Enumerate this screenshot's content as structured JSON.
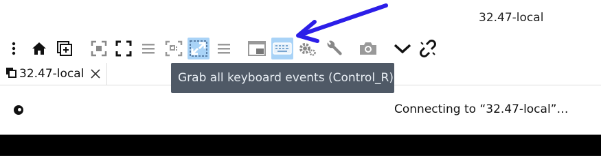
{
  "window": {
    "title": "32.47-local"
  },
  "toolbar": {
    "items": [
      {
        "icon": "kebab-menu-icon"
      },
      {
        "icon": "home-icon"
      },
      {
        "icon": "new-window-icon"
      },
      {
        "icon": "fit-window-icon"
      },
      {
        "icon": "fullscreen-icon"
      },
      {
        "icon": "menu-lines-icon"
      },
      {
        "icon": "scale-icon"
      },
      {
        "icon": "resize-to-fit-icon",
        "active": true
      },
      {
        "icon": "menu-lines-icon"
      },
      {
        "icon": "picture-in-picture-icon"
      },
      {
        "icon": "keyboard-icon",
        "active": true
      },
      {
        "icon": "gears-icon"
      },
      {
        "icon": "wrench-icon"
      },
      {
        "icon": "camera-icon"
      },
      {
        "icon": "chevron-down-icon"
      },
      {
        "icon": "disconnect-link-icon"
      }
    ]
  },
  "tab": {
    "label": "32.47-local"
  },
  "tooltip": {
    "text": "Grab all keyboard events (Control_R)"
  },
  "status": {
    "text": "Connecting to “32.47-local”…"
  },
  "colors": {
    "accent": "#a9d3f7",
    "arrow": "#2c1ee8",
    "tooltip_bg": "#4f5966"
  }
}
